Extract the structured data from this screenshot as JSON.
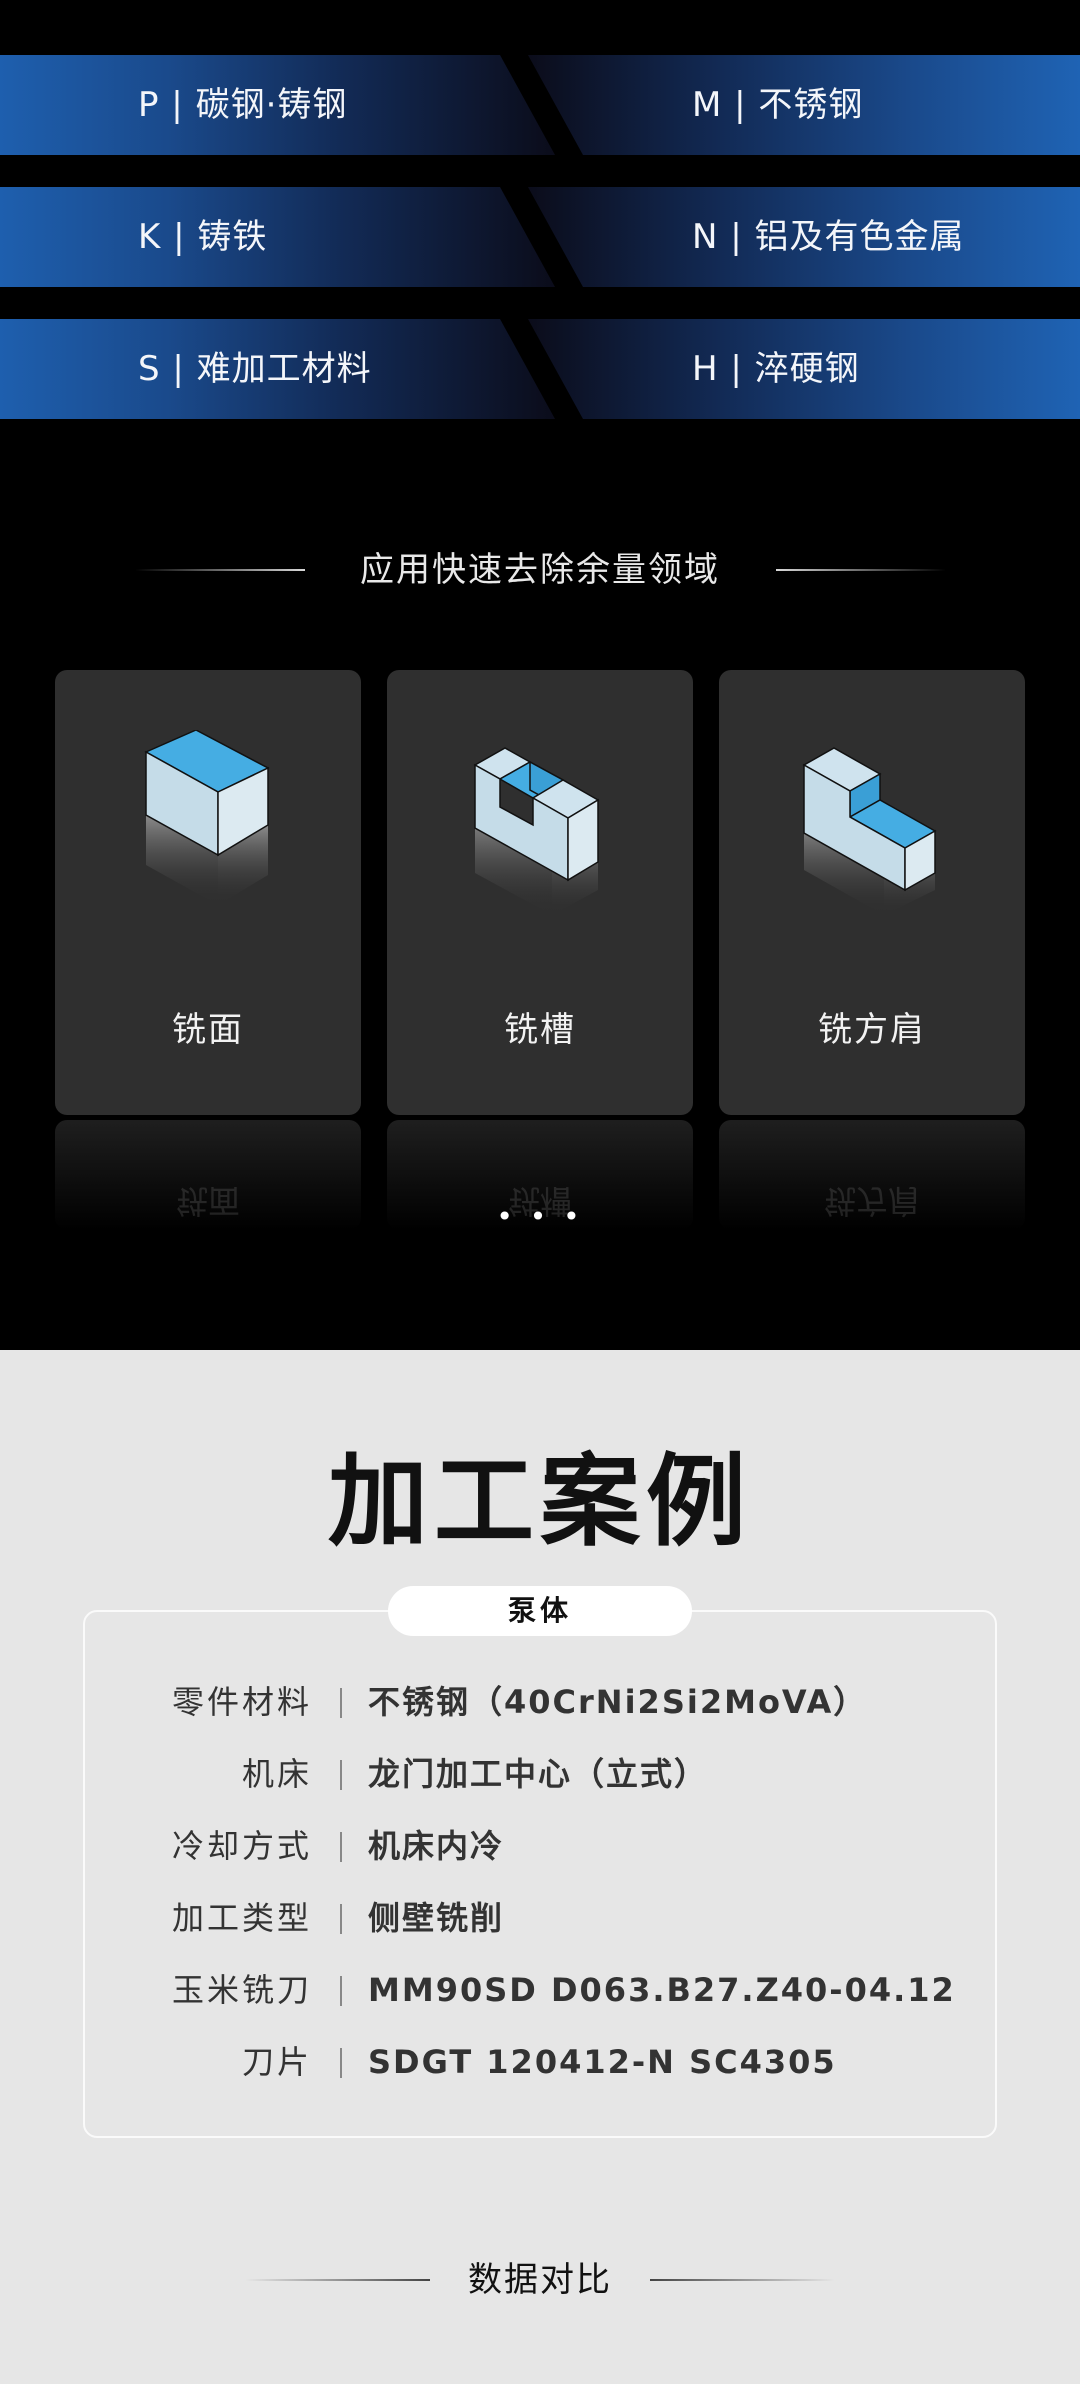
{
  "materials": [
    {
      "left": "P | 碳钢·铸钢",
      "right": "M | 不锈钢"
    },
    {
      "left": "K | 铸铁",
      "right": "N | 铝及有色金属"
    },
    {
      "left": "S | 难加工材料",
      "right": "H | 淬硬钢"
    }
  ],
  "application": {
    "title": "应用快速去除余量领域",
    "cards": [
      {
        "label": "铣面",
        "icon": "face-milling-icon"
      },
      {
        "label": "铣槽",
        "icon": "slot-milling-icon"
      },
      {
        "label": "铣方肩",
        "icon": "shoulder-milling-icon"
      }
    ],
    "pager": "• • •"
  },
  "case": {
    "title": "加工案例",
    "part": "泵体",
    "specs": [
      {
        "key": "零件材料",
        "value": "不锈钢（40CrNi2Si2MoVA）"
      },
      {
        "key": "机床",
        "value": "龙门加工中心（立式）"
      },
      {
        "key": "冷却方式",
        "value": "机床内冷"
      },
      {
        "key": "加工类型",
        "value": "侧壁铣削"
      },
      {
        "key": "玉米铣刀",
        "value": "MM90SD D063.B27.Z40-04.12"
      },
      {
        "key": "刀片",
        "value": "SDGT 120412-N SC4305"
      }
    ]
  },
  "compare": {
    "title": "数据对比"
  },
  "colors": {
    "blue": "#1f63b4",
    "cube_top": "#45ade3",
    "cube_side": "#cfe3ee"
  }
}
